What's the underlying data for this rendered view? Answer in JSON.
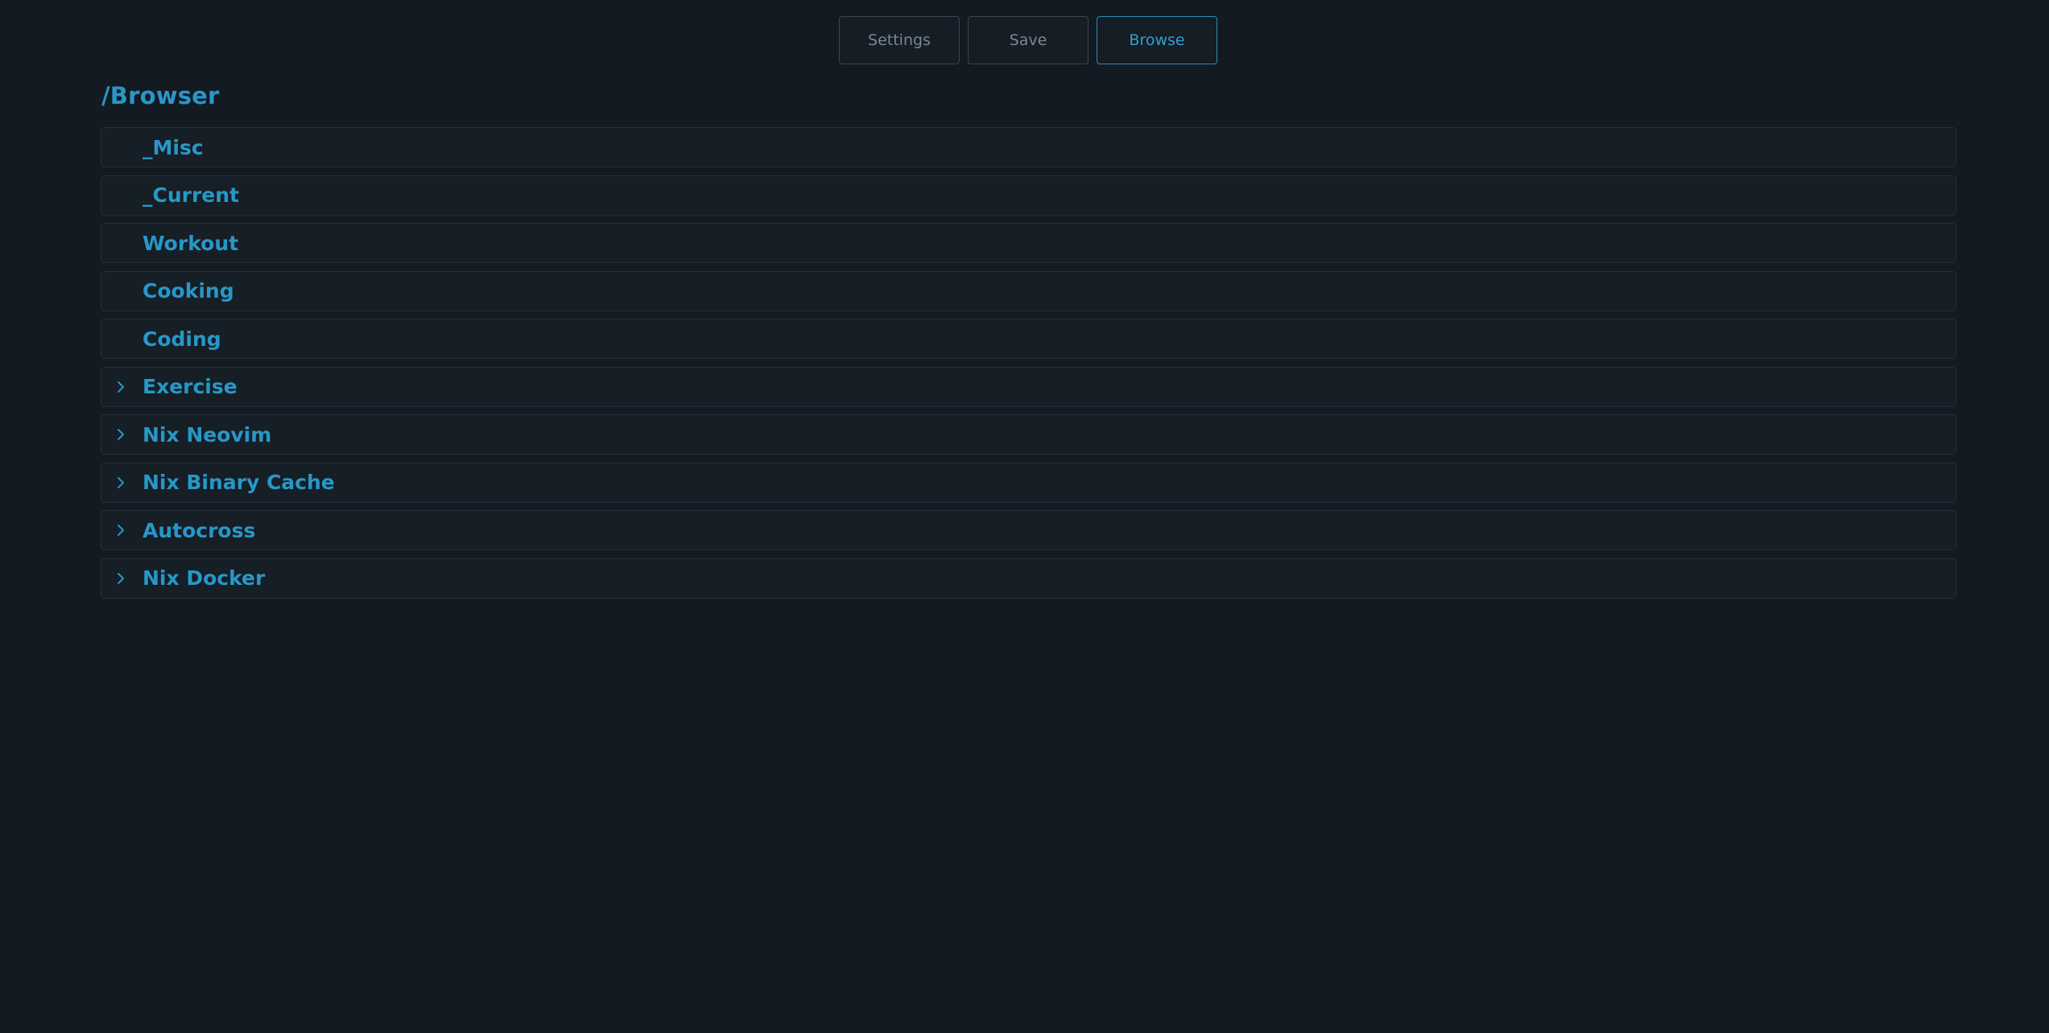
{
  "nav": {
    "buttons": [
      {
        "label": "Settings",
        "active": false
      },
      {
        "label": "Save",
        "active": false
      },
      {
        "label": "Browse",
        "active": true
      }
    ]
  },
  "page": {
    "title": "/Browser"
  },
  "folders": [
    {
      "label": "_Misc",
      "expandable": false
    },
    {
      "label": "_Current",
      "expandable": false
    },
    {
      "label": "Workout",
      "expandable": false
    },
    {
      "label": "Cooking",
      "expandable": false
    },
    {
      "label": "Coding",
      "expandable": false
    },
    {
      "label": "Exercise",
      "expandable": true,
      "icon": "chevron-right-icon"
    },
    {
      "label": "Nix Neovim",
      "expandable": true,
      "icon": "chevron-right-icon"
    },
    {
      "label": "Nix Binary Cache",
      "expandable": true,
      "icon": "chevron-right-icon"
    },
    {
      "label": "Autocross",
      "expandable": true,
      "icon": "chevron-right-icon"
    },
    {
      "label": "Nix Docker",
      "expandable": true,
      "icon": "chevron-right-icon"
    }
  ],
  "colors": {
    "background": "#131a21",
    "accent": "#2897c7",
    "row_background": "#161e26",
    "row_border": "#26303a",
    "button_text": "#7b8791"
  }
}
